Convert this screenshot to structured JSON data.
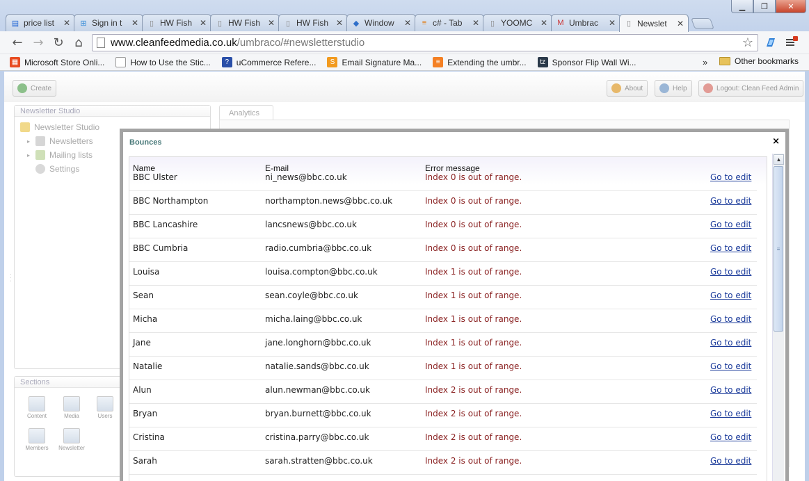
{
  "browser": {
    "tabs": [
      {
        "label": "price list",
        "icon": "doc-icon",
        "active": false
      },
      {
        "label": "Sign in t",
        "icon": "windows-icon",
        "active": false
      },
      {
        "label": "HW Fish",
        "icon": "page-icon",
        "active": false
      },
      {
        "label": "HW Fish",
        "icon": "page-icon",
        "active": false
      },
      {
        "label": "HW Fish",
        "icon": "page-icon",
        "active": false
      },
      {
        "label": "Window",
        "icon": "window-icon",
        "active": false
      },
      {
        "label": "c# - Tab",
        "icon": "stack-icon",
        "active": false
      },
      {
        "label": "YOOMC",
        "icon": "page-icon",
        "active": false
      },
      {
        "label": "Umbrac",
        "icon": "gmail-icon",
        "active": false
      },
      {
        "label": "Newslet",
        "icon": "page-icon",
        "active": true
      }
    ],
    "tab_close_glyph": "✕",
    "url_host": "www.cleanfeedmedia.co.uk",
    "url_path": "/umbraco/#newsletterstudio",
    "bookmarks": [
      {
        "label": "Microsoft Store Onli...",
        "icon": "ms-store-icon",
        "color": "#e84c22"
      },
      {
        "label": "How to Use the Stic...",
        "icon": "page-icon",
        "color": "#ffffff"
      },
      {
        "label": "uCommerce Refere...",
        "icon": "question-icon",
        "color": "#2a4fa8"
      },
      {
        "label": "Email Signature Ma...",
        "icon": "s-icon",
        "color": "#f29a1f"
      },
      {
        "label": "Extending the umbr...",
        "icon": "stack-icon",
        "color": "#f48024"
      },
      {
        "label": "Sponsor Flip Wall Wi...",
        "icon": "tz-icon",
        "color": "#2b3a4a"
      }
    ],
    "more_label": "»",
    "other_bookmarks": "Other bookmarks"
  },
  "umbraco": {
    "create_label": "Create",
    "about_label": "About",
    "help_label": "Help",
    "logout_label": "Logout: Clean Feed Admin",
    "tree_title": "Newsletter Studio",
    "tree_root": "Newsletter Studio",
    "tree_items": [
      "Newsletters",
      "Mailing lists",
      "Settings"
    ],
    "sections_title": "Sections",
    "sections": [
      "Content",
      "Media",
      "Users",
      "Members",
      "Newsletter"
    ],
    "app_tab": "Analytics"
  },
  "modal": {
    "title": "Bounces",
    "close_glyph": "×",
    "columns": {
      "name": "Name",
      "email": "E-mail",
      "error": "Error message"
    },
    "rows": [
      {
        "name": "BBC Ulster",
        "email": "ni_news@bbc.co.uk",
        "error": "Index 0 is out of range.",
        "action": "Go to edit"
      },
      {
        "name": "BBC Northampton",
        "email": "northampton.news@bbc.co.uk",
        "error": "Index 0 is out of range.",
        "action": "Go to edit"
      },
      {
        "name": "BBC Lancashire",
        "email": "lancsnews@bbc.co.uk",
        "error": "Index 0 is out of range.",
        "action": "Go to edit"
      },
      {
        "name": "BBC Cumbria",
        "email": "radio.cumbria@bbc.co.uk",
        "error": "Index 0 is out of range.",
        "action": "Go to edit"
      },
      {
        "name": "Louisa",
        "email": "louisa.compton@bbc.co.uk",
        "error": "Index 1 is out of range.",
        "action": "Go to edit"
      },
      {
        "name": "Sean",
        "email": "sean.coyle@bbc.co.uk",
        "error": "Index 1 is out of range.",
        "action": "Go to edit"
      },
      {
        "name": "Micha",
        "email": "micha.laing@bbc.co.uk",
        "error": "Index 1 is out of range.",
        "action": "Go to edit"
      },
      {
        "name": "Jane",
        "email": "jane.longhorn@bbc.co.uk",
        "error": "Index 1 is out of range.",
        "action": "Go to edit"
      },
      {
        "name": "Natalie",
        "email": "natalie.sands@bbc.co.uk",
        "error": "Index 1 is out of range.",
        "action": "Go to edit"
      },
      {
        "name": "Alun",
        "email": "alun.newman@bbc.co.uk",
        "error": "Index 2 is out of range.",
        "action": "Go to edit"
      },
      {
        "name": "Bryan",
        "email": "bryan.burnett@bbc.co.uk",
        "error": "Index 2 is out of range.",
        "action": "Go to edit"
      },
      {
        "name": "Cristina",
        "email": "cristina.parry@bbc.co.uk",
        "error": "Index 2 is out of range.",
        "action": "Go to edit"
      },
      {
        "name": "Sarah",
        "email": "sarah.stratten@bbc.co.uk",
        "error": "Index 2 is out of range.",
        "action": "Go to edit"
      }
    ]
  }
}
